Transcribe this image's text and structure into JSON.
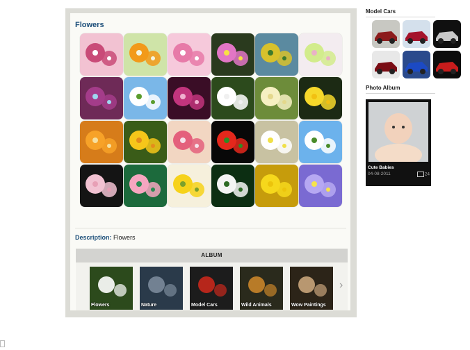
{
  "gallery": {
    "title": "Flowers",
    "description_label": "Description:",
    "description_value": "Flowers",
    "thumbs": [
      {
        "c1": "#f2c2d2",
        "c2": "#c94b78",
        "c3": "#fff"
      },
      {
        "c1": "#cfe4a8",
        "c2": "#f29a1a",
        "c3": "#f5f5e0"
      },
      {
        "c1": "#f6c9db",
        "c2": "#e77aa8",
        "c3": "#fff"
      },
      {
        "c1": "#2a3a1e",
        "c2": "#e276c5",
        "c3": "#f8e046"
      },
      {
        "c1": "#5b8aa0",
        "c2": "#d8c12c",
        "c3": "#3e7a2c"
      },
      {
        "c1": "#f3ecf0",
        "c2": "#d2ec8c",
        "c3": "#e9b2c6"
      },
      {
        "c1": "#6e2a57",
        "c2": "#a43c8a",
        "c3": "#9ed7f0"
      },
      {
        "c1": "#7ab7e8",
        "c2": "#ffffff",
        "c3": "#5a9c2c"
      },
      {
        "c1": "#3a0d26",
        "c2": "#c2357d",
        "c3": "#f0b0d0"
      },
      {
        "c1": "#2c4a1c",
        "c2": "#ffffff",
        "c3": "#f0f0f0"
      },
      {
        "c1": "#6d8c3a",
        "c2": "#f6f0c2",
        "c3": "#e4d88c"
      },
      {
        "c1": "#1c2a14",
        "c2": "#f6d82a",
        "c3": "#f2c012"
      },
      {
        "c1": "#d67c1a",
        "c2": "#f7a228",
        "c3": "#f6e0a0"
      },
      {
        "c1": "#3a5c18",
        "c2": "#f6c61a",
        "c3": "#e48c1c"
      },
      {
        "c1": "#f2d6c2",
        "c2": "#e4607c",
        "c3": "#f6e2ea"
      },
      {
        "c1": "#080808",
        "c2": "#e4281c",
        "c3": "#2e8c24"
      },
      {
        "c1": "#c8c2a2",
        "c2": "#ffffff",
        "c3": "#f0e048"
      },
      {
        "c1": "#6cb2ec",
        "c2": "#ffffff",
        "c3": "#4a8c2a"
      },
      {
        "c1": "#141414",
        "c2": "#f2c2d2",
        "c3": "#e8a0b6"
      },
      {
        "c1": "#1c6a3c",
        "c2": "#f6a6c0",
        "c3": "#2a8c54"
      },
      {
        "c1": "#f6f0dc",
        "c2": "#f6d21a",
        "c3": "#7ca02c"
      },
      {
        "c1": "#0c2e12",
        "c2": "#f4f4f4",
        "c3": "#2c6a24"
      },
      {
        "c1": "#c69c0c",
        "c2": "#f6d81c",
        "c3": "#ecc40c"
      },
      {
        "c1": "#7a6ad2",
        "c2": "#b6a8f2",
        "c3": "#f6e44c"
      }
    ]
  },
  "album": {
    "header": "ALBUM",
    "items": [
      {
        "label": "Flowers",
        "bg": "#2c4a1c",
        "fg": "#ffffff"
      },
      {
        "label": "Nature",
        "bg": "#2a3a4a",
        "fg": "#7a8a9a"
      },
      {
        "label": "Model Cars",
        "bg": "#1c1c1c",
        "fg": "#c8281c"
      },
      {
        "label": "Wild Animals",
        "bg": "#2a2a1c",
        "fg": "#c8842a"
      },
      {
        "label": "Wow Paintings",
        "bg": "#2c2418",
        "fg": "#c8a47a"
      }
    ]
  },
  "sidebar": {
    "model_cars_title": "Model Cars",
    "cars": [
      {
        "bg": "#c8c8c2",
        "body": "#8c1c1c"
      },
      {
        "bg": "#d4e0ec",
        "body": "#a4142c"
      },
      {
        "bg": "#101010",
        "body": "#c8c8c8"
      },
      {
        "bg": "#e8e8e8",
        "body": "#7a0c14"
      },
      {
        "bg": "#2a4a8c",
        "body": "#1c4ac4"
      },
      {
        "bg": "#0c0c0c",
        "body": "#c81c1c"
      }
    ],
    "photo_album_title": "Photo Album",
    "photo": {
      "name": "Cute Babies",
      "date": "04-08-2011",
      "count": "24"
    }
  }
}
